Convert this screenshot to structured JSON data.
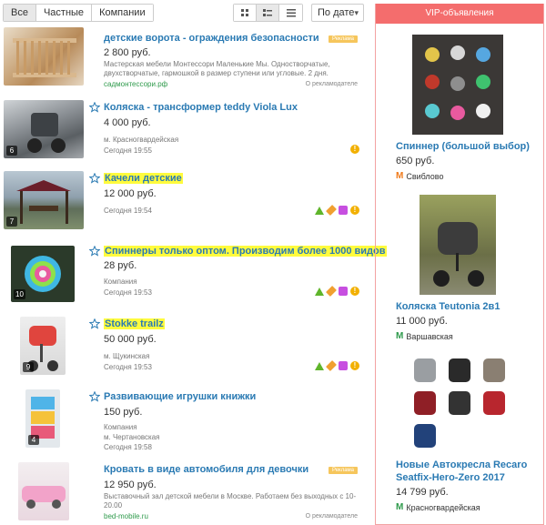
{
  "filters": {
    "tabs": [
      "Все",
      "Частные",
      "Компании"
    ],
    "active_tab": 0
  },
  "view_modes": {
    "icons": [
      "grid-icon",
      "list-icon",
      "compact-list-icon"
    ],
    "active": 1
  },
  "sort": {
    "label": "По дате"
  },
  "listings": [
    {
      "title": "детские ворота - ограждения безопасности",
      "price": "2 800 руб.",
      "desc": "Мастерская мебели Монтессори Маленькие Мы. Одностворчатые, двухстворчатые, гармошкой в размер ступени или угловые. 2 дня.",
      "site": "садмонтессори.рф",
      "ad_note": "О рекламодателе",
      "promo": "Реклама"
    },
    {
      "title": "Коляска - трансформер teddy Viola Lux",
      "price": "4 000 руб.",
      "metro": "м. Красногвардейская",
      "date": "Сегодня 19:55",
      "photos": "6"
    },
    {
      "title": "Качели детские",
      "price": "12 000 руб.",
      "date": "Сегодня 19:54",
      "photos": "7"
    },
    {
      "title": "Спиннеры только оптом. Производим более 1000 видов",
      "price": "28 руб.",
      "seller": "Компания",
      "date": "Сегодня 19:53",
      "photos": "10"
    },
    {
      "title": "Stokke trailz",
      "price": "50 000 руб.",
      "metro": "м. Щукинская",
      "date": "Сегодня 19:53",
      "photos": "9"
    },
    {
      "title": "Развивающие игрушки книжки",
      "price": "150 руб.",
      "seller": "Компания",
      "metro": "м. Чертановская",
      "date": "Сегодня 19:58",
      "photos": "4"
    },
    {
      "title": "Кровать в виде автомобиля для девочки",
      "price": "12 950 руб.",
      "desc": "Выставочный зал детской мебели в Москве. Работаем без выходных с 10-20.00",
      "site": "bed-mobile.ru",
      "ad_note": "О рекламодателе",
      "promo": "Реклама"
    }
  ],
  "vip": {
    "header": "VIP-объявления",
    "items": [
      {
        "title": "Спиннер (большой выбор)",
        "price": "650 руб.",
        "metro": "Свиблово",
        "metro_color": "#f07a1a"
      },
      {
        "title": "Коляска Teutonia 2в1",
        "price": "11 000 руб.",
        "metro": "Варшавская",
        "metro_color": "#2e9a4b"
      },
      {
        "title": "Новые Автокресла Recaro Seatfix-Hero-Zero 2017",
        "price": "14 799 руб.",
        "metro": "Красногвардейская",
        "metro_color": "#2e9a4b"
      }
    ],
    "seat_labels": [
      "aluminium grey",
      "carbon black",
      "dark sand",
      "ruby red",
      "performance black",
      "racing red",
      "cobalt blue"
    ]
  },
  "colors": {
    "accent": "#2a7ab3",
    "vip_header": "#f46d6d",
    "highlight": "#fffb3d"
  }
}
